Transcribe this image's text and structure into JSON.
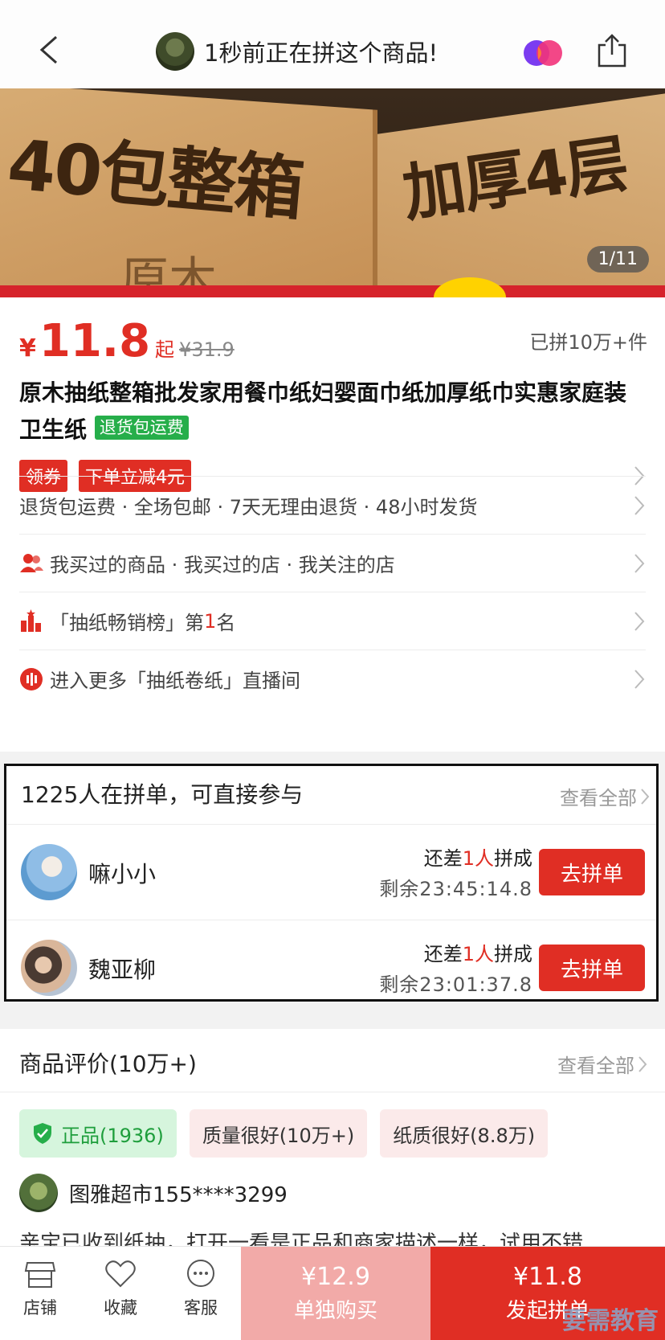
{
  "header": {
    "notice": "1秒前正在拼这个商品!"
  },
  "hero": {
    "counter": "1/11",
    "left_text": "40包整箱",
    "right_text": "加厚4层",
    "brand_text": "原木"
  },
  "product": {
    "price_symbol": "¥",
    "price": "11.8",
    "price_suffix": "起",
    "original_price": "¥31.9",
    "sold": "已拼10万+件",
    "title": "原木抽纸整箱批发家用餐巾纸妇婴面巾纸加厚纸巾实惠家庭装卫生纸",
    "title_badge": "退货包运费",
    "coupons": [
      "领券",
      "下单立减4元"
    ],
    "services": "退货包运费 · 全场包邮 · 7天无理由退货 · 48小时发货",
    "history": "我买过的商品 · 我买过的店 · 我关注的店",
    "rank_prefix": "「抽纸畅销榜」第",
    "rank_num": "1",
    "rank_suffix": "名",
    "live": "进入更多「抽纸卷纸」直播间"
  },
  "group": {
    "heading": "1225人在拼单，可直接参与",
    "see_all": "查看全部",
    "members": [
      {
        "name": "嘛小小",
        "need_prefix": "还差",
        "need_num": "1人",
        "need_suffix": "拼成",
        "remain": "剩余23:45:14.8",
        "button": "去拼单"
      },
      {
        "name": "魏亚柳",
        "need_prefix": "还差",
        "need_num": "1人",
        "need_suffix": "拼成",
        "remain": "剩余23:01:37.8",
        "button": "去拼单"
      }
    ]
  },
  "reviews": {
    "heading": "商品评价(10万+)",
    "see_all": "查看全部",
    "tags": [
      "正品(1936)",
      "质量很好(10万+)",
      "纸质很好(8.8万)"
    ],
    "reviewer": "图雅超市155****3299",
    "text": "亲宝已收到纸抽，打开一看是正品和商家描述一样，试用不错"
  },
  "bottom": {
    "shop": "店铺",
    "favorite": "收藏",
    "service": "客服",
    "single_price": "¥12.9",
    "single_label": "单独购买",
    "group_price": "¥11.8",
    "group_label": "发起拼单",
    "watermark": "要需教育"
  },
  "colors": {
    "accent": "#e02e24",
    "green": "#26ae4a",
    "single_btn": "#f2aaa8"
  }
}
